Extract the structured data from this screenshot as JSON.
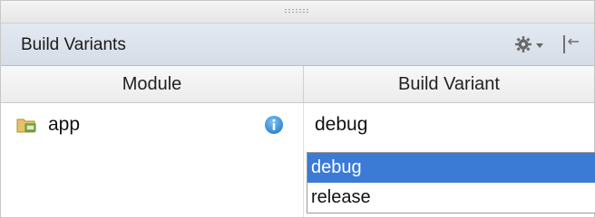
{
  "panel": {
    "title": "Build Variants"
  },
  "table": {
    "headers": {
      "module": "Module",
      "variant": "Build Variant"
    },
    "rows": [
      {
        "module": "app",
        "build_variant": "debug"
      }
    ]
  },
  "variant_dropdown": {
    "options": [
      "debug",
      "release"
    ],
    "selected": "debug"
  },
  "colors": {
    "header_bg": "#dbe2eb",
    "selected_option_bg": "#3b7ad5",
    "info_icon": "#3d96df"
  },
  "icons": {
    "settings": "gear-icon",
    "pin": "pin-icon",
    "folder": "folder-icon",
    "info": "info-icon"
  }
}
